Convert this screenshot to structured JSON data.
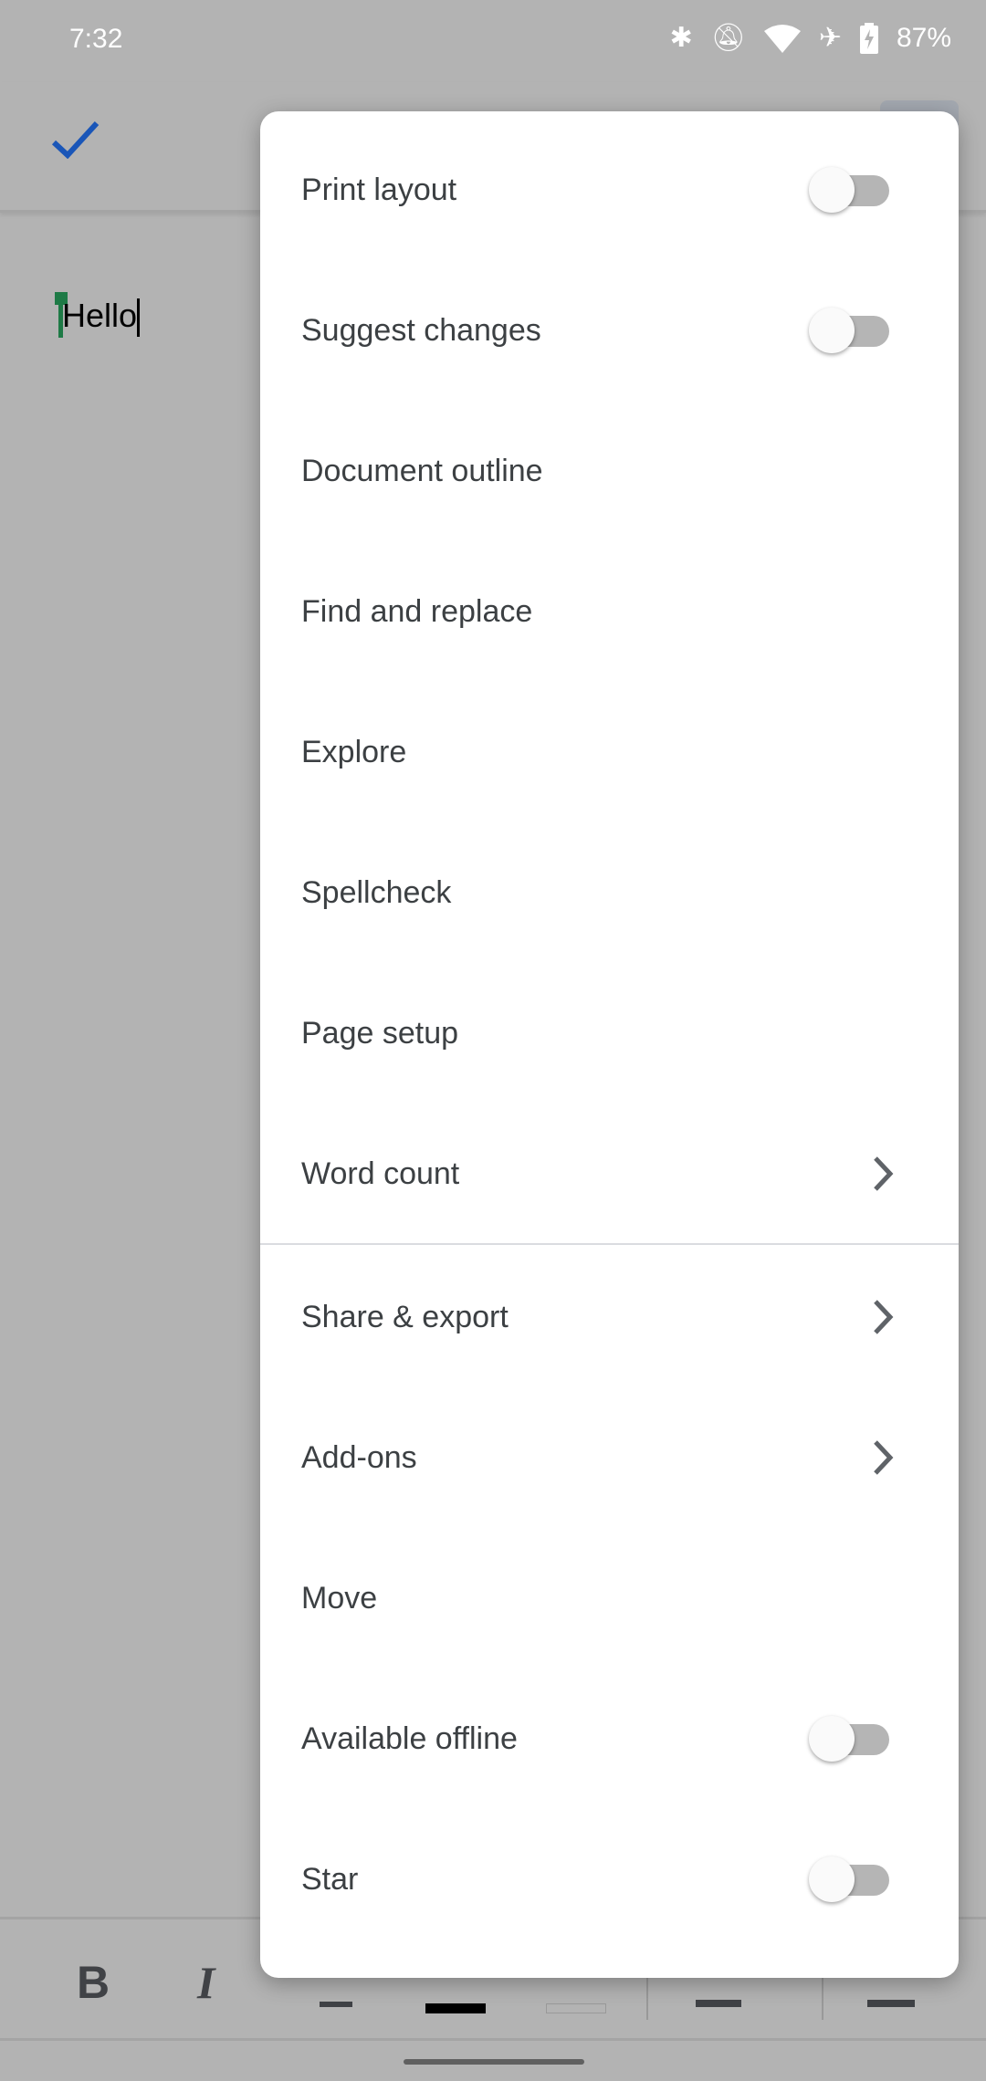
{
  "status_bar": {
    "time": "7:32",
    "battery": "87%",
    "icons": [
      "bluetooth-icon",
      "notifications-off-icon",
      "wifi-icon",
      "airplane-mode-icon",
      "battery-charging-icon"
    ]
  },
  "app_bar": {
    "done_icon": "check-icon",
    "accent": "#1a56b8"
  },
  "document": {
    "text": "Hello",
    "cursor_color": "#1e7a46"
  },
  "menu": {
    "items": [
      {
        "label": "Print layout",
        "type": "toggle",
        "on": false
      },
      {
        "label": "Suggest changes",
        "type": "toggle",
        "on": false
      },
      {
        "label": "Document outline",
        "type": "plain"
      },
      {
        "label": "Find and replace",
        "type": "plain"
      },
      {
        "label": "Explore",
        "type": "plain"
      },
      {
        "label": "Spellcheck",
        "type": "plain"
      },
      {
        "label": "Page setup",
        "type": "plain"
      },
      {
        "label": "Word count",
        "type": "submenu"
      },
      {
        "label": "Share & export",
        "type": "submenu"
      },
      {
        "label": "Add-ons",
        "type": "submenu"
      },
      {
        "label": "Move",
        "type": "plain"
      },
      {
        "label": "Available offline",
        "type": "toggle",
        "on": false
      },
      {
        "label": "Star",
        "type": "toggle",
        "on": false
      }
    ]
  },
  "format_toolbar": {
    "bold": "B",
    "italic": "I",
    "items": [
      "bold-icon",
      "italic-icon",
      "underline-icon",
      "text-color-icon",
      "highlight-icon",
      "align-icon",
      "list-icon"
    ]
  }
}
